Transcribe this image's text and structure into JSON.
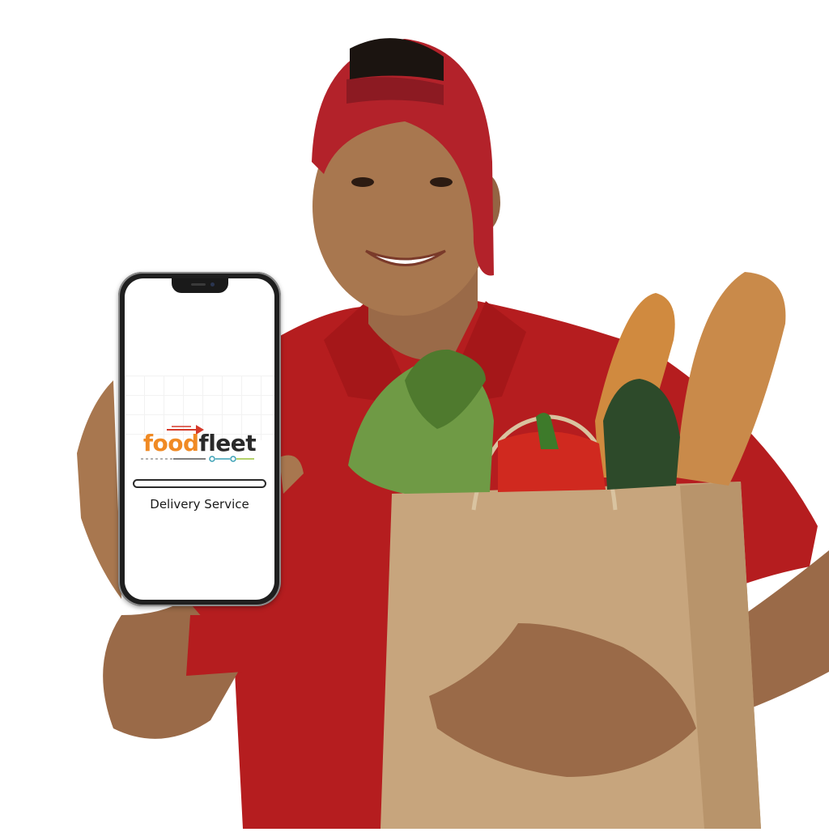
{
  "app": {
    "logo_part1": "food",
    "logo_part2": "fleet",
    "subtitle": "Delivery Service",
    "colors": {
      "logo_orange": "#f08a24",
      "logo_dark": "#2a2a2a",
      "shirt_red": "#b51d1f",
      "bag_kraft": "#c7a57d"
    }
  },
  "icons": {
    "logo_arrow": "red-arrow-icon",
    "logo_track": "delivery-track-icon"
  }
}
